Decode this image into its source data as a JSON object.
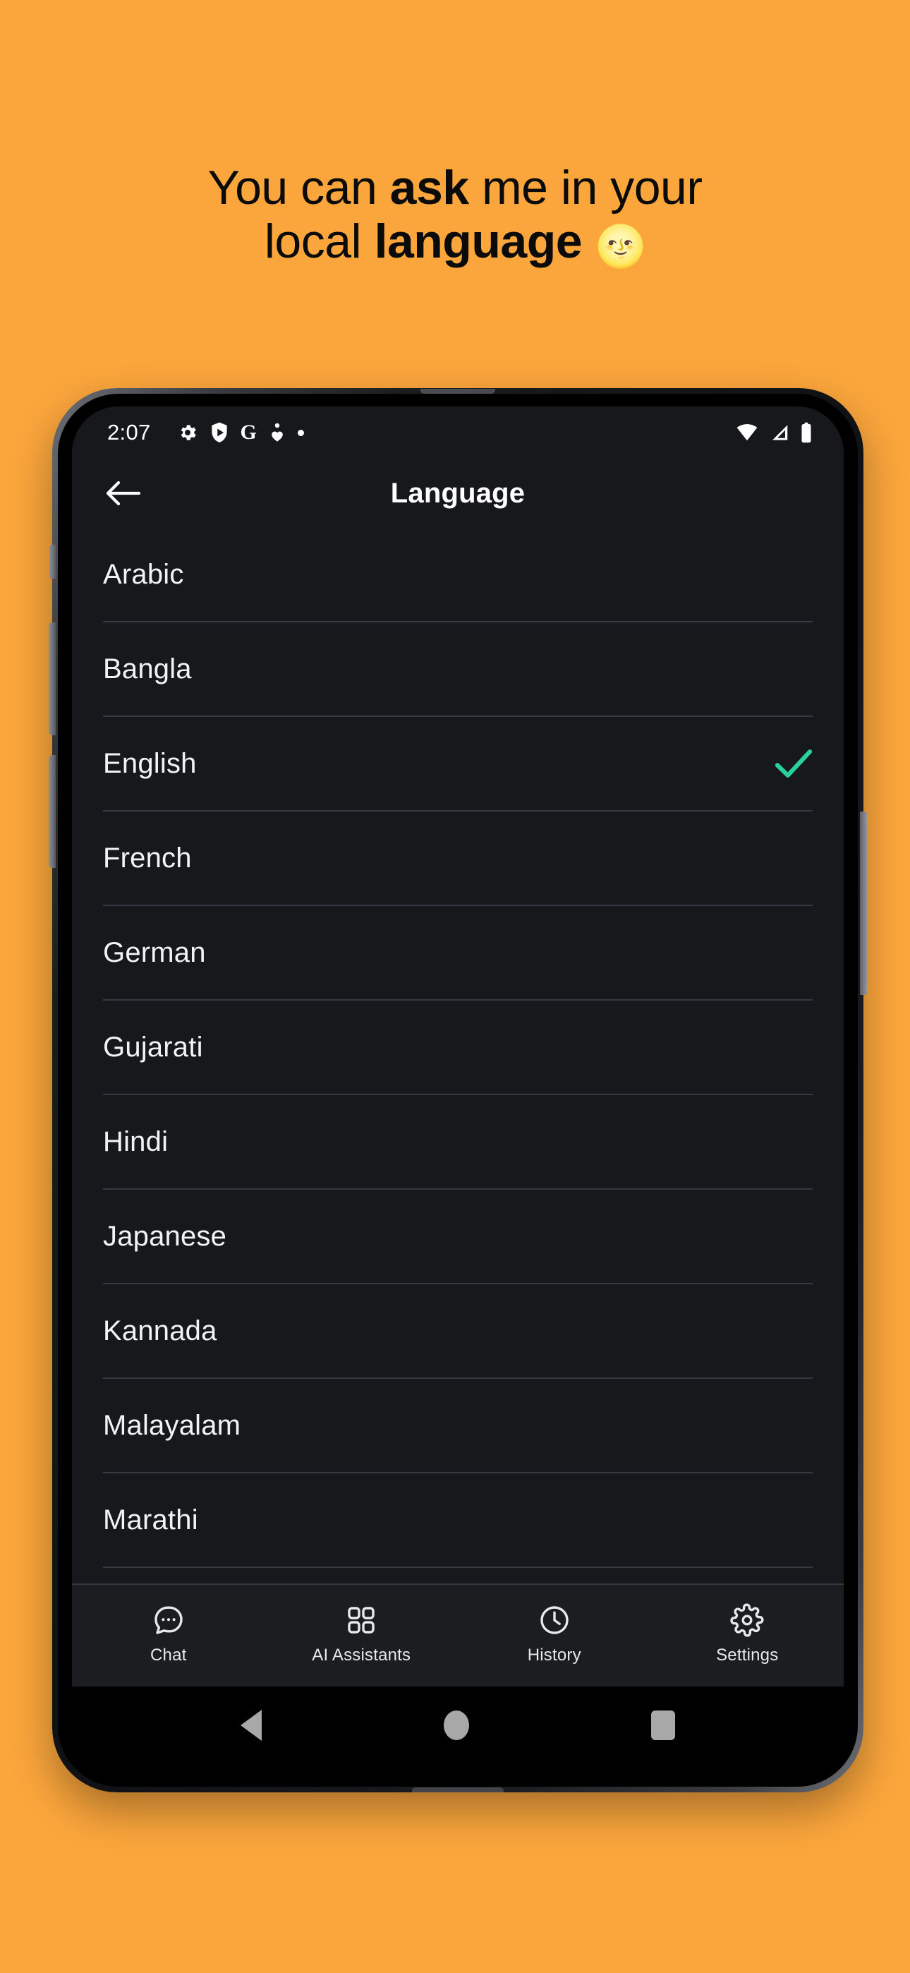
{
  "promo": {
    "line1_pre": "You can ",
    "line1_bold": "ask",
    "line1_post": " me in your",
    "line2_pre": "local ",
    "line2_bold": "language",
    "line2_emoji": "🌝",
    "background_color": "#FBA63C",
    "text_color": "#0B0B0B"
  },
  "status_bar": {
    "time": "2:07",
    "left_icons": [
      "gear-icon",
      "play-protect-shield-icon",
      "google-g-icon",
      "health-heart-icon",
      "dot-icon"
    ],
    "google_letter": "G",
    "right_icons": [
      "wifi-icon",
      "cellular-signal-icon",
      "battery-icon"
    ]
  },
  "app_bar": {
    "back_icon": "arrow-left-icon",
    "title": "Language"
  },
  "language_list": {
    "selected": "English",
    "check_color": "#2BD19A",
    "items": [
      {
        "name": "Arabic",
        "selected": false
      },
      {
        "name": "Bangla",
        "selected": false
      },
      {
        "name": "English",
        "selected": true
      },
      {
        "name": "French",
        "selected": false
      },
      {
        "name": "German",
        "selected": false
      },
      {
        "name": "Gujarati",
        "selected": false
      },
      {
        "name": "Hindi",
        "selected": false
      },
      {
        "name": "Japanese",
        "selected": false
      },
      {
        "name": "Kannada",
        "selected": false
      },
      {
        "name": "Malayalam",
        "selected": false
      },
      {
        "name": "Marathi",
        "selected": false
      }
    ]
  },
  "bottom_nav": {
    "active": "Chat",
    "items": [
      {
        "label": "Chat",
        "icon": "chat-bubble-icon"
      },
      {
        "label": "AI Assistants",
        "icon": "grid-squares-icon"
      },
      {
        "label": "History",
        "icon": "clock-icon"
      },
      {
        "label": "Settings",
        "icon": "gear-icon"
      }
    ]
  },
  "system_nav": {
    "items": [
      "back-triangle-icon",
      "home-circle-icon",
      "recents-square-icon"
    ]
  },
  "theme": {
    "screen_background": "#16181C",
    "divider": "#343A42",
    "nav_background": "#1B1D21"
  }
}
